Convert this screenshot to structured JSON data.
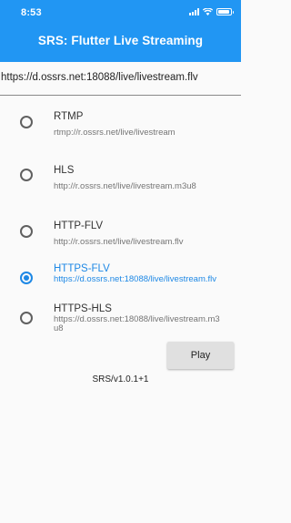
{
  "status_bar": {
    "time": "8:53"
  },
  "app_bar": {
    "title": "SRS: Flutter Live Streaming"
  },
  "url_input": {
    "value": "https://d.ossrs.net:18088/live/livestream.flv"
  },
  "options": [
    {
      "title": "RTMP",
      "url": "rtmp://r.ossrs.net/live/livestream",
      "selected": false
    },
    {
      "title": "HLS",
      "url": "http://r.ossrs.net/live/livestream.m3u8",
      "selected": false
    },
    {
      "title": "HTTP-FLV",
      "url": "http://r.ossrs.net/live/livestream.flv",
      "selected": false
    },
    {
      "title": "HTTPS-FLV",
      "url": "https://d.ossrs.net:18088/live/livestream.flv",
      "selected": true
    },
    {
      "title": "HTTPS-HLS",
      "url": "https://d.ossrs.net:18088/live/livestream.m3u8",
      "selected": false
    }
  ],
  "play_button": {
    "label": "Play"
  },
  "version": "SRS/v1.0.1+1",
  "colors": {
    "primary": "#2196f3",
    "selected": "#1e88e5"
  }
}
